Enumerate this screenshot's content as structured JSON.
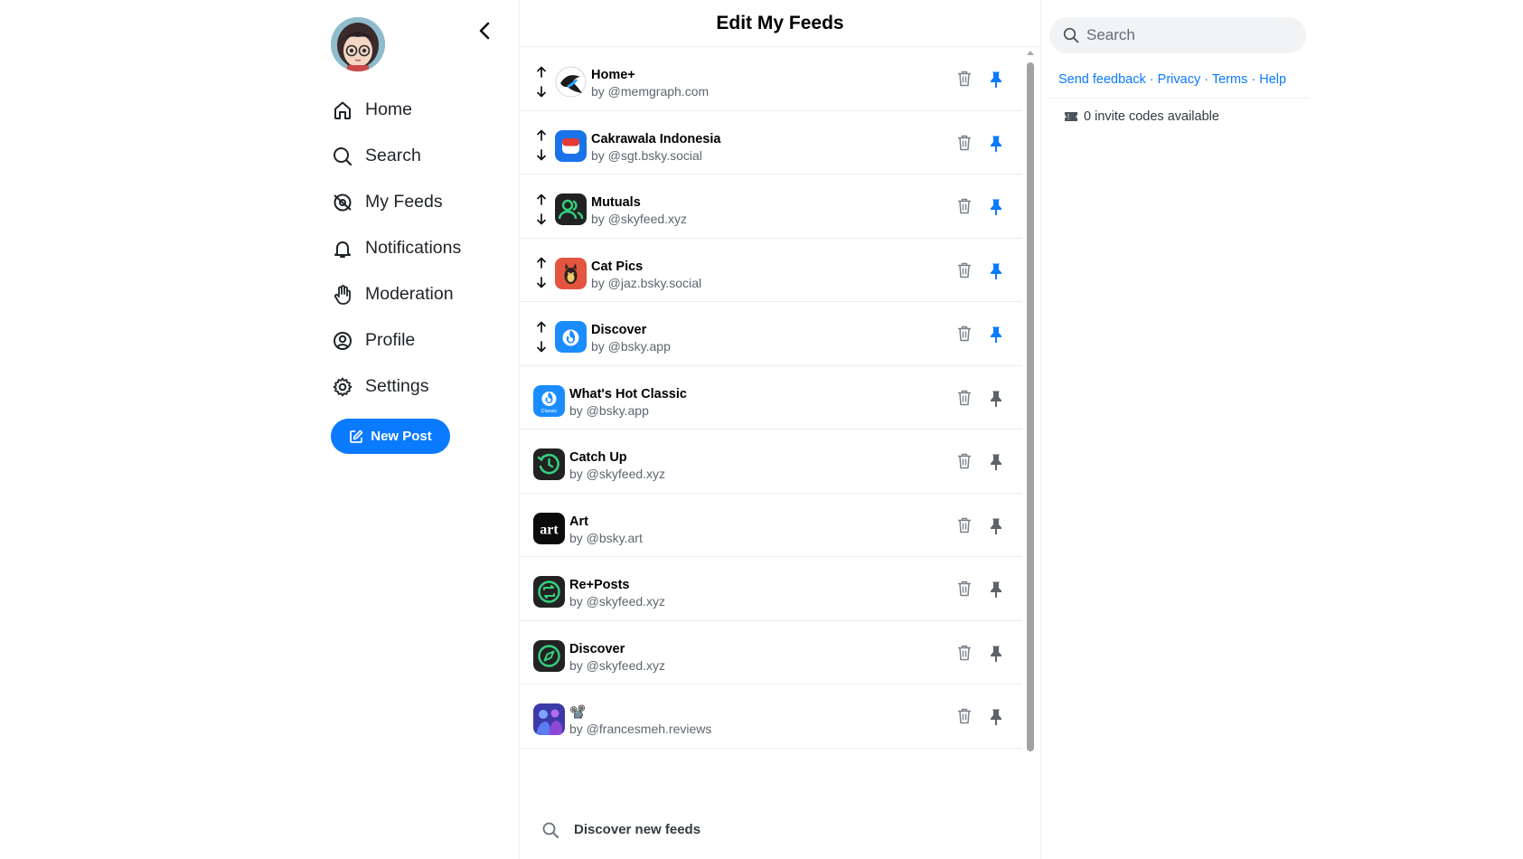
{
  "nav": {
    "items": [
      {
        "label": "Home",
        "icon": "home-icon"
      },
      {
        "label": "Search",
        "icon": "search-icon"
      },
      {
        "label": "My Feeds",
        "icon": "feeds-icon"
      },
      {
        "label": "Notifications",
        "icon": "bell-icon"
      },
      {
        "label": "Moderation",
        "icon": "hand-icon"
      },
      {
        "label": "Profile",
        "icon": "user-circle-icon"
      },
      {
        "label": "Settings",
        "icon": "gear-icon"
      }
    ],
    "new_post_label": "New Post"
  },
  "header": {
    "title": "Edit My Feeds"
  },
  "feeds": [
    {
      "name": "Home+",
      "by": "by @memgraph.com",
      "pinned": true,
      "reorderable": true,
      "icon": "bird-icon"
    },
    {
      "name": "Cakrawala Indonesia",
      "by": "by @sgt.bsky.social",
      "pinned": true,
      "reorderable": true,
      "icon": "flag-icon"
    },
    {
      "name": "Mutuals",
      "by": "by @skyfeed.xyz",
      "pinned": true,
      "reorderable": true,
      "icon": "users-icon"
    },
    {
      "name": "Cat Pics",
      "by": "by @jaz.bsky.social",
      "pinned": true,
      "reorderable": true,
      "icon": "cat-icon"
    },
    {
      "name": "Discover",
      "by": "by @bsky.app",
      "pinned": true,
      "reorderable": true,
      "icon": "flame-icon"
    },
    {
      "name": "What's Hot Classic",
      "by": "by @bsky.app",
      "pinned": false,
      "reorderable": false,
      "icon": "flame-classic-icon",
      "icon_caption": "Classic"
    },
    {
      "name": "Catch Up",
      "by": "by @skyfeed.xyz",
      "pinned": false,
      "reorderable": false,
      "icon": "clock-icon"
    },
    {
      "name": "Art",
      "by": "by @bsky.art",
      "pinned": false,
      "reorderable": false,
      "icon": "art-icon",
      "icon_text": "art"
    },
    {
      "name": "Re+Posts",
      "by": "by @skyfeed.xyz",
      "pinned": false,
      "reorderable": false,
      "icon": "repost-icon"
    },
    {
      "name": "Discover",
      "by": "by @skyfeed.xyz",
      "pinned": false,
      "reorderable": false,
      "icon": "compass-icon"
    },
    {
      "name": "📽️",
      "by": "by @francesmeh.reviews",
      "pinned": false,
      "reorderable": false,
      "icon": "film-icon"
    }
  ],
  "discover_new": {
    "label": "Discover new feeds"
  },
  "right": {
    "search_placeholder": "Search",
    "links": [
      "Send feedback",
      "Privacy",
      "Terms",
      "Help"
    ],
    "link_separator": "·",
    "invite_text": "0 invite codes available"
  },
  "colors": {
    "accent": "#0a7aff",
    "pin_active": "#0a7aff",
    "pin_inactive": "#5f6368",
    "text_muted": "#5e6670"
  }
}
